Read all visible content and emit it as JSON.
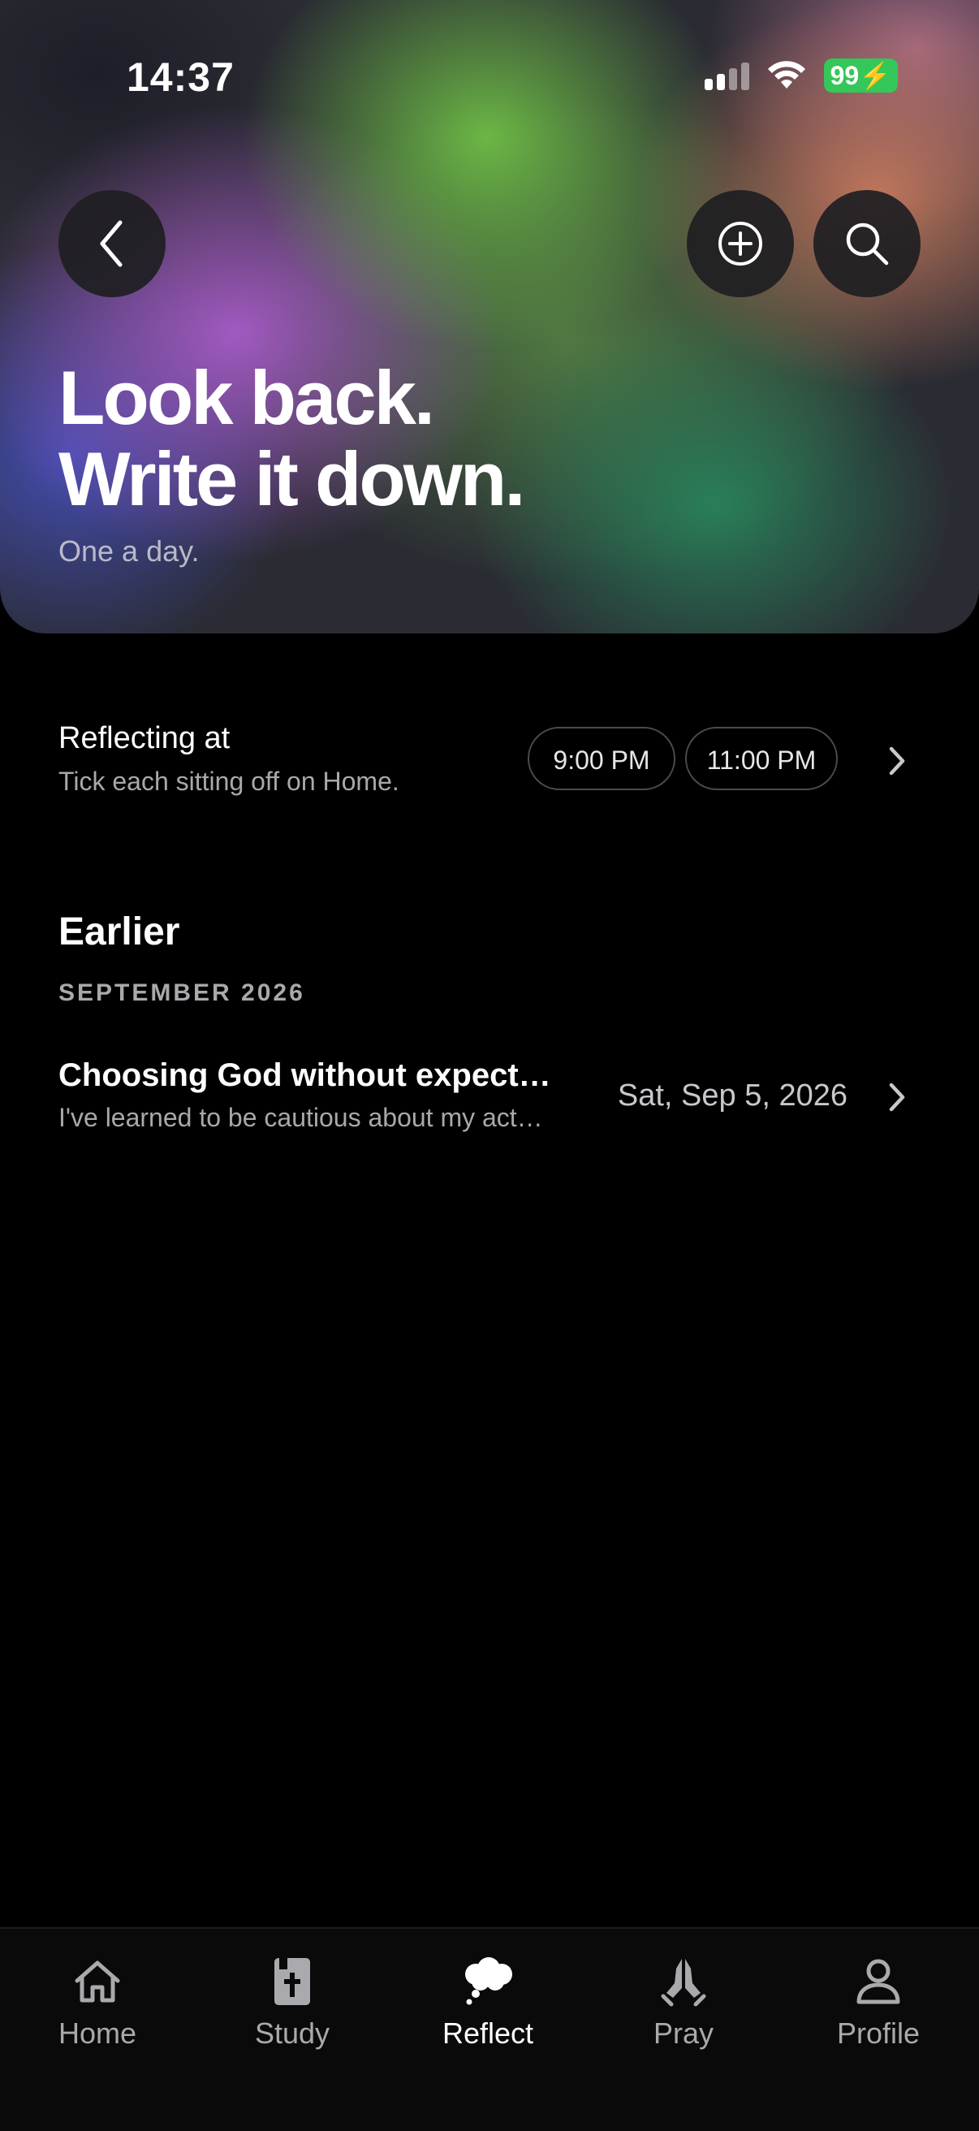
{
  "status": {
    "time": "14:37",
    "battery": "99"
  },
  "hero": {
    "title_line1": "Look back.",
    "title_line2": "Write it down.",
    "subtitle": "One a day."
  },
  "reminders": {
    "title": "Reflecting at",
    "subtitle": "Tick each sitting off on Home.",
    "times": [
      "9:00 PM",
      "11:00 PM"
    ]
  },
  "earlier": {
    "title": "Earlier",
    "month": "SEPTEMBER 2026",
    "entries": [
      {
        "title": "Choosing God without expect…",
        "preview": "I've learned to be cautious about my act…",
        "date": "Sat, Sep 5, 2026"
      }
    ]
  },
  "tabs": [
    {
      "label": "Home",
      "icon": "home-icon"
    },
    {
      "label": "Study",
      "icon": "bible-icon"
    },
    {
      "label": "Reflect",
      "icon": "thought-cloud-icon",
      "active": true
    },
    {
      "label": "Pray",
      "icon": "praying-hands-icon"
    },
    {
      "label": "Profile",
      "icon": "person-icon"
    }
  ],
  "colors": {
    "background": "#000000",
    "battery": "#34c759",
    "muted_text": "#a8a8ad"
  }
}
